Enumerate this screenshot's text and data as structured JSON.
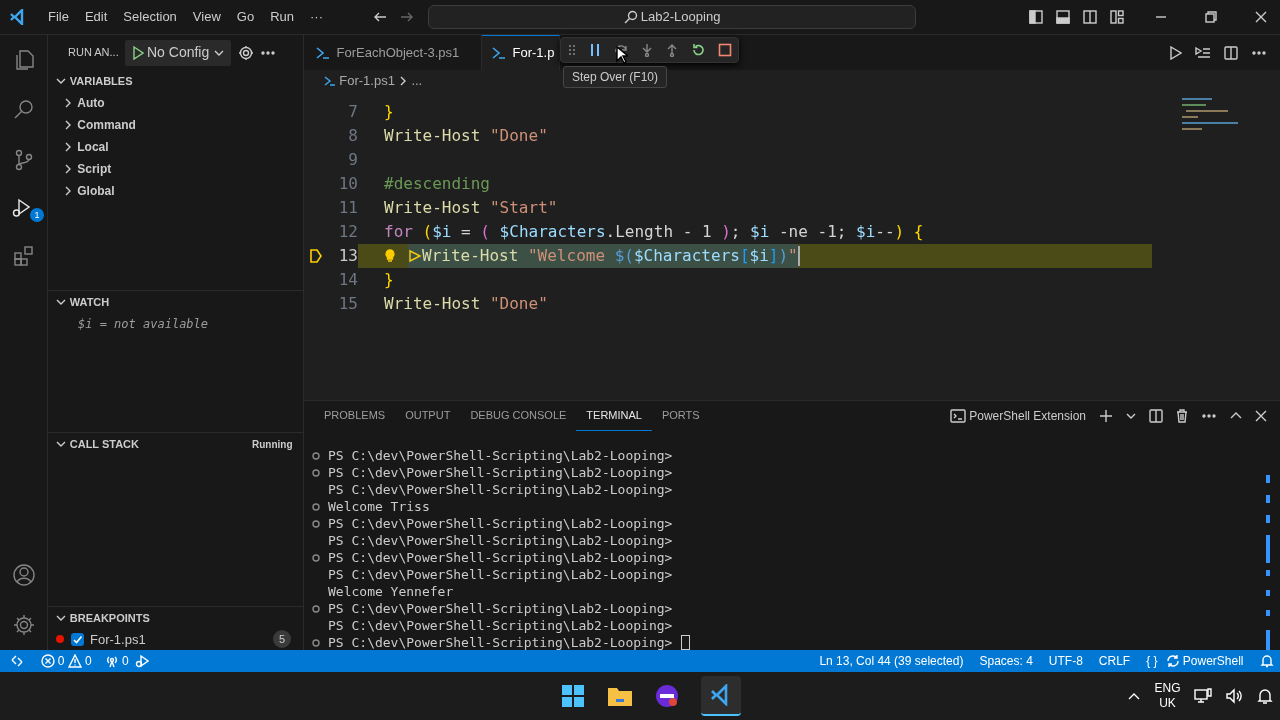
{
  "title_bar": {
    "menu": [
      "File",
      "Edit",
      "Selection",
      "View",
      "Go",
      "Run",
      "···"
    ],
    "search": "Lab2-Looping"
  },
  "activity_bar": {
    "debug_badge": "1"
  },
  "run_view": {
    "title": "RUN AN...",
    "config": "No Config"
  },
  "variables": {
    "title": "VARIABLES",
    "expanded": true,
    "items": [
      {
        "label": "Auto",
        "expanded": false
      },
      {
        "label": "Command",
        "expanded": false
      },
      {
        "label": "Local",
        "expanded": false
      },
      {
        "label": "Script",
        "expanded": false
      },
      {
        "label": "Global",
        "expanded": false
      }
    ]
  },
  "watch": {
    "title": "WATCH",
    "expanded": true,
    "items": [
      "$i = not available"
    ]
  },
  "call_stack": {
    "title": "CALL STACK",
    "expanded": true,
    "status": "Running"
  },
  "breakpoints": {
    "title": "BREAKPOINTS",
    "expanded": true,
    "items": [
      {
        "label": "For-1.ps1",
        "checked": true,
        "count": "5"
      }
    ]
  },
  "tabs": [
    {
      "label": "ForEachObject-3.ps1",
      "selected": false
    },
    {
      "label": "For-1.p",
      "selected": true
    }
  ],
  "debug_toolbar": {
    "tooltip": "Step Over (F10)"
  },
  "breadcrumb": [
    "For-1.ps1",
    "..."
  ],
  "editor": {
    "lines": [
      {
        "number": "7",
        "indented": false,
        "current": false,
        "selected": false,
        "tokens": [
          {
            "kind": "brace",
            "text": "}"
          }
        ]
      },
      {
        "number": "8",
        "indented": false,
        "current": false,
        "selected": false,
        "tokens": [
          {
            "kind": "fn",
            "text": "Write-Host "
          },
          {
            "kind": "str",
            "text": "\"Done\""
          }
        ]
      },
      {
        "number": "9",
        "indented": false,
        "current": false,
        "selected": false
      },
      {
        "number": "10",
        "indented": false,
        "current": false,
        "selected": false,
        "tokens": [
          {
            "kind": "cmt",
            "text": "#descending"
          }
        ]
      },
      {
        "number": "11",
        "indented": false,
        "current": false,
        "selected": false,
        "tokens": [
          {
            "kind": "fn",
            "text": "Write-Host "
          },
          {
            "kind": "str",
            "text": "\"Start\""
          }
        ]
      },
      {
        "number": "12",
        "indented": false,
        "current": false,
        "selected": false,
        "tokens": [
          {
            "kind": "kw",
            "text": "for "
          },
          {
            "kind": "brace",
            "text": "("
          },
          {
            "kind": "var",
            "text": "$i"
          },
          {
            "kind": "op",
            "text": " = "
          },
          {
            "kind": "paren",
            "text": "("
          },
          {
            "kind": "var",
            "text": " $Characters"
          },
          {
            "kind": "op",
            "text": ".Length - 1 "
          },
          {
            "kind": "paren",
            "text": ")"
          },
          {
            "kind": "op",
            "text": "; "
          },
          {
            "kind": "var",
            "text": "$i"
          },
          {
            "kind": "op",
            "text": " -ne -1; "
          },
          {
            "kind": "var",
            "text": "$i"
          },
          {
            "kind": "op",
            "text": "--"
          },
          {
            "kind": "brace",
            "text": ")"
          },
          {
            "kind": "brace",
            "text": " {"
          }
        ]
      },
      {
        "number": "13",
        "indented": true,
        "current": true,
        "selected": true,
        "tokens": [
          {
            "kind": "fn",
            "text": "Write-Host "
          },
          {
            "kind": "str",
            "text": "\"Welcome "
          },
          {
            "kind": "sub",
            "text": "$("
          },
          {
            "kind": "var",
            "text": "$Characters"
          },
          {
            "kind": "bracket",
            "text": "["
          },
          {
            "kind": "var",
            "text": "$i"
          },
          {
            "kind": "bracket",
            "text": "]"
          },
          {
            "kind": "sub",
            "text": ")"
          },
          {
            "kind": "str",
            "text": "\""
          }
        ]
      },
      {
        "number": "14",
        "indented": false,
        "current": false,
        "selected": false,
        "tokens": [
          {
            "kind": "brace",
            "text": "}"
          }
        ]
      },
      {
        "number": "15",
        "indented": false,
        "current": false,
        "selected": false,
        "tokens": [
          {
            "kind": "fn",
            "text": "Write-Host "
          },
          {
            "kind": "str",
            "text": "\"Done\""
          }
        ]
      }
    ]
  },
  "panel": {
    "tabs": [
      {
        "label": "PROBLEMS",
        "selected": false
      },
      {
        "label": "OUTPUT",
        "selected": false
      },
      {
        "label": "DEBUG CONSOLE",
        "selected": false
      },
      {
        "label": "TERMINAL",
        "selected": true
      },
      {
        "label": "PORTS",
        "selected": false
      }
    ],
    "terminal_name": "PowerShell Extension",
    "terminal_lines": [
      {
        "text": "PS C:\\dev\\PowerShell-Scripting\\Lab2-Looping>",
        "marker": true,
        "cursor": false
      },
      {
        "text": "PS C:\\dev\\PowerShell-Scripting\\Lab2-Looping>",
        "marker": true,
        "cursor": false
      },
      {
        "text": "PS C:\\dev\\PowerShell-Scripting\\Lab2-Looping>",
        "marker": false,
        "cursor": false
      },
      {
        "text": "Welcome Triss",
        "marker": true,
        "cursor": false
      },
      {
        "text": "PS C:\\dev\\PowerShell-Scripting\\Lab2-Looping>",
        "marker": true,
        "cursor": false
      },
      {
        "text": "PS C:\\dev\\PowerShell-Scripting\\Lab2-Looping>",
        "marker": false,
        "cursor": false
      },
      {
        "text": "PS C:\\dev\\PowerShell-Scripting\\Lab2-Looping>",
        "marker": true,
        "cursor": false
      },
      {
        "text": "PS C:\\dev\\PowerShell-Scripting\\Lab2-Looping>",
        "marker": false,
        "cursor": false
      },
      {
        "text": "Welcome Yennefer",
        "marker": false,
        "cursor": false
      },
      {
        "text": "PS C:\\dev\\PowerShell-Scripting\\Lab2-Looping>",
        "marker": true,
        "cursor": false
      },
      {
        "text": "PS C:\\dev\\PowerShell-Scripting\\Lab2-Looping>",
        "marker": false,
        "cursor": false
      },
      {
        "text": "PS C:\\dev\\PowerShell-Scripting\\Lab2-Looping>",
        "marker": true,
        "cursor": true
      }
    ]
  },
  "status_bar": {
    "errors": "0",
    "warnings": "0",
    "ports": "0",
    "position": "Ln 13, Col 44 (39 selected)",
    "spaces": "Spaces: 4",
    "encoding": "UTF-8",
    "eol": "CRLF",
    "braces": "{ }",
    "language": "PowerShell"
  },
  "taskbar": {
    "language": "ENG",
    "region": "UK"
  }
}
